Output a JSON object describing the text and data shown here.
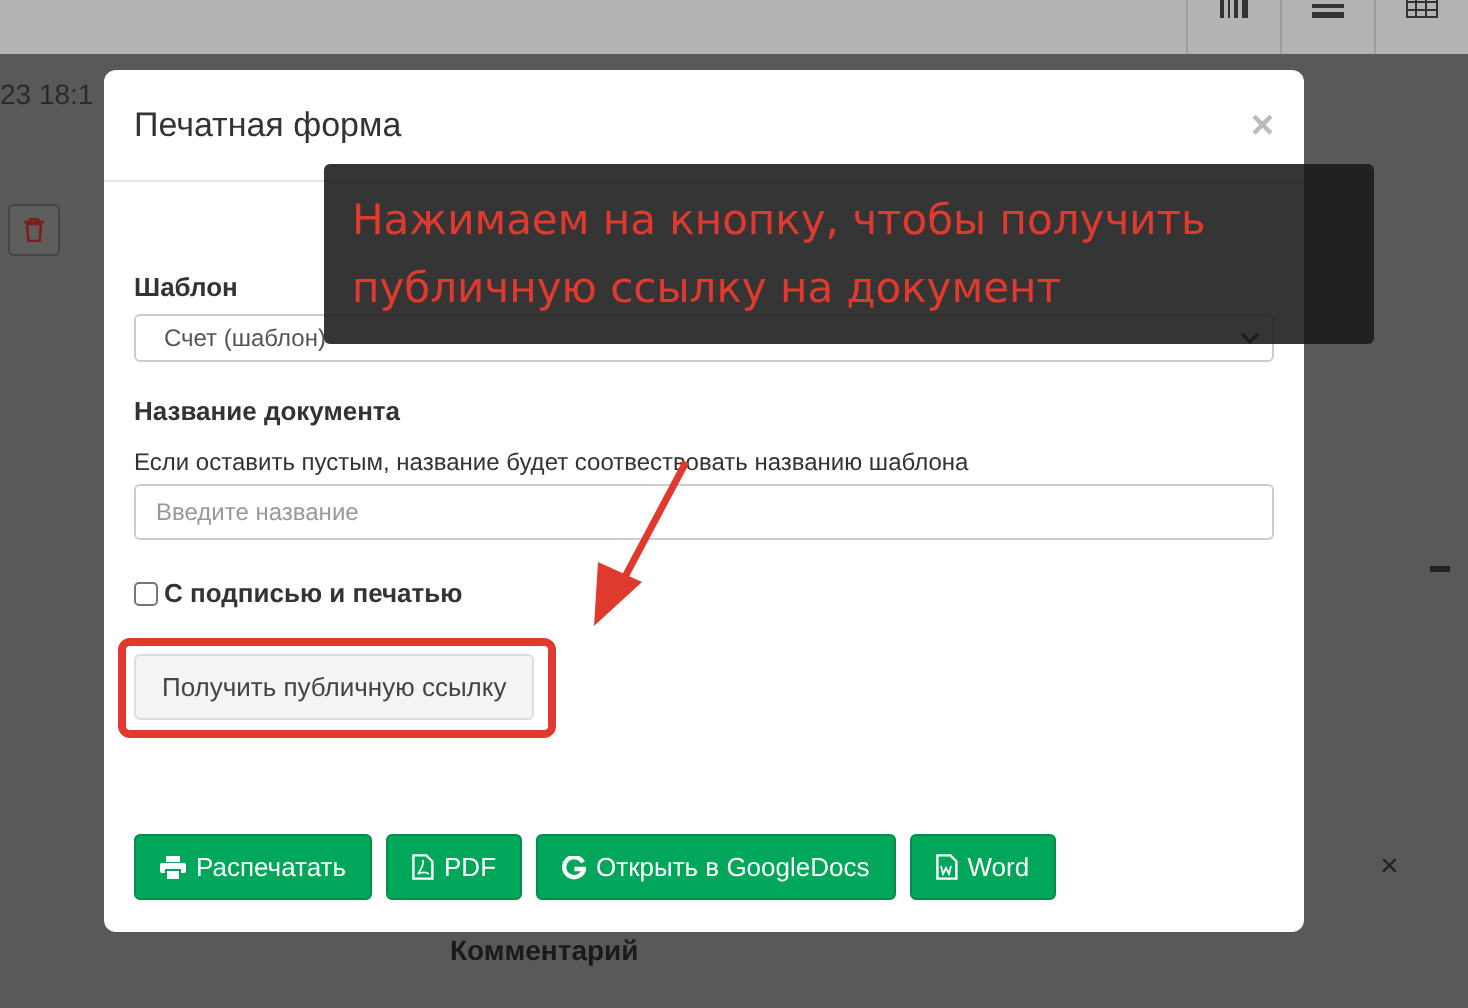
{
  "backdrop": {
    "timestamp": "23 18:1",
    "comment_label": "Комментарий",
    "clear_mark": "×"
  },
  "modal": {
    "title": "Печатная форма",
    "close": "×",
    "template": {
      "label": "Шаблон",
      "value": "Счет (шаблон)"
    },
    "doc_name": {
      "label": "Название документа",
      "help": "Если оставить пустым, название будет соотвествовать названию шаблона",
      "placeholder": "Введите название"
    },
    "signature": {
      "label": "С подписью и печатью",
      "checked": false
    },
    "link_button": "Получить публичную ссылку",
    "actions": [
      {
        "kind": "print",
        "label": "Распечатать"
      },
      {
        "kind": "pdf",
        "label": "PDF"
      },
      {
        "kind": "google",
        "label": "Открыть в GoogleDocs"
      },
      {
        "kind": "word",
        "label": "Word"
      }
    ]
  },
  "annotation": {
    "text": "Нажимаем на кнопку, чтобы получить публичную ссылку на документ"
  }
}
